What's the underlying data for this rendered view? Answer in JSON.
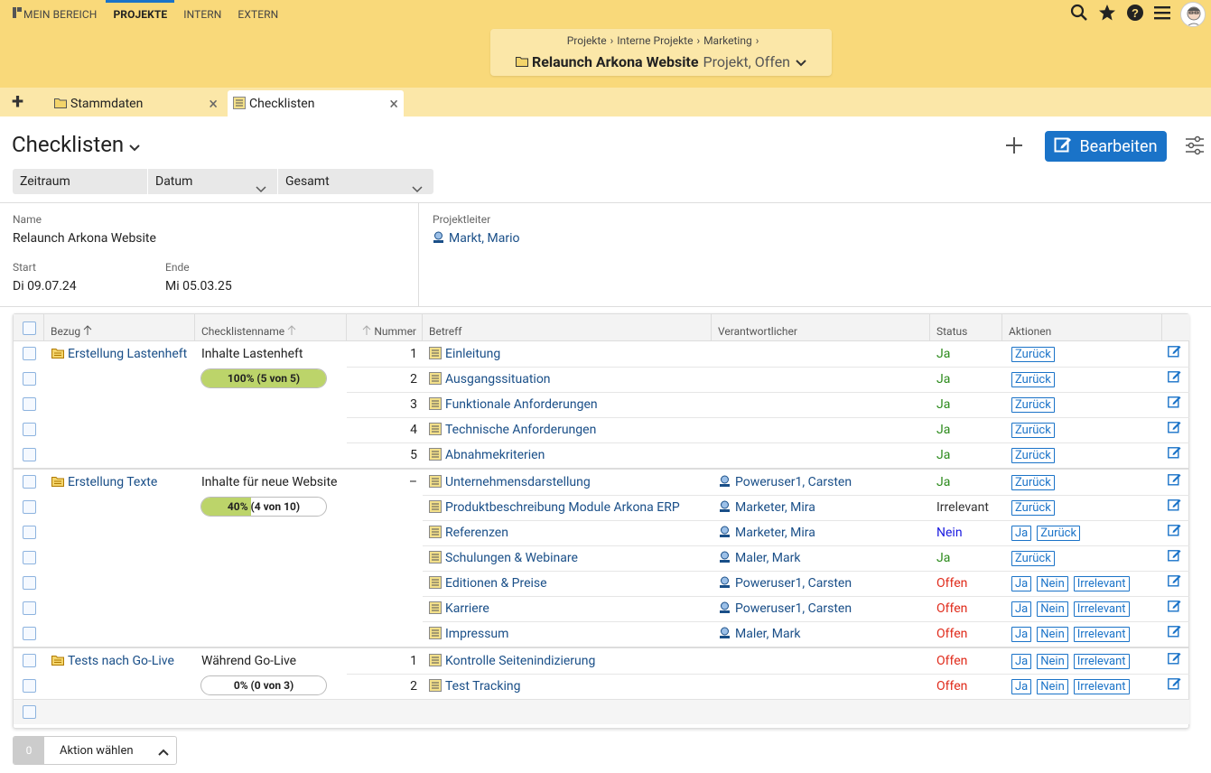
{
  "nav": {
    "items": [
      "MEIN BEREICH",
      "PROJEKTE",
      "INTERN",
      "EXTERN"
    ],
    "active_index": 1
  },
  "breadcrumb": [
    "Projekte",
    "Interne Projekte",
    "Marketing"
  ],
  "project": {
    "title": "Relaunch Arkona Website",
    "subtitle": "Projekt, Offen"
  },
  "tabs": [
    {
      "label": "Stammdaten"
    },
    {
      "label": "Checklisten"
    }
  ],
  "page": {
    "title": "Checklisten",
    "edit_label": "Bearbeiten"
  },
  "filters": [
    {
      "label": "Zeitraum"
    },
    {
      "label": "Datum"
    },
    {
      "label": "Gesamt"
    }
  ],
  "info": {
    "name_label": "Name",
    "name_value": "Relaunch Arkona Website",
    "start_label": "Start",
    "start_value": "Di 09.07.24",
    "end_label": "Ende",
    "end_value": "Mi 05.03.25",
    "lead_label": "Projektleiter",
    "lead_value": "Markt, Mario"
  },
  "table": {
    "headers": {
      "bezug": "Bezug",
      "checkliste": "Checklistenname",
      "nummer": "Nummer",
      "betreff": "Betreff",
      "verantwortlicher": "Verantwortlicher",
      "status": "Status",
      "aktionen": "Aktionen"
    },
    "groups": [
      {
        "bezug": "Erstellung Lastenheft",
        "checkliste": "Inhalte Lastenheft",
        "progress_label": "100% (5 von 5)",
        "progress": 1.0,
        "rows": [
          {
            "nummer": "1",
            "betreff": "Einleitung",
            "verantwortlicher": "",
            "status": "Ja",
            "actions": [
              "Zurück"
            ]
          },
          {
            "nummer": "2",
            "betreff": "Ausgangssituation",
            "verantwortlicher": "",
            "status": "Ja",
            "actions": [
              "Zurück"
            ]
          },
          {
            "nummer": "3",
            "betreff": "Funktionale Anforderungen",
            "verantwortlicher": "",
            "status": "Ja",
            "actions": [
              "Zurück"
            ]
          },
          {
            "nummer": "4",
            "betreff": "Technische Anforderungen",
            "verantwortlicher": "",
            "status": "Ja",
            "actions": [
              "Zurück"
            ]
          },
          {
            "nummer": "5",
            "betreff": "Abnahmekriterien",
            "verantwortlicher": "",
            "status": "Ja",
            "actions": [
              "Zurück"
            ]
          }
        ]
      },
      {
        "bezug": "Erstellung Texte",
        "checkliste": "Inhalte für neue Website",
        "progress_label": "40% (4 von 10)",
        "progress": 0.4,
        "rows": [
          {
            "nummer": "–",
            "betreff": "Unternehmensdarstellung",
            "verantwortlicher": "Poweruser1, Carsten",
            "status": "Ja",
            "actions": [
              "Zurück"
            ]
          },
          {
            "nummer": "",
            "betreff": "Produktbeschreibung Module Arkona ERP",
            "verantwortlicher": "Marketer, Mira",
            "status": "Irrelevant",
            "actions": [
              "Zurück"
            ]
          },
          {
            "nummer": "",
            "betreff": "Referenzen",
            "verantwortlicher": "Marketer, Mira",
            "status": "Nein",
            "actions": [
              "Ja",
              "Zurück"
            ]
          },
          {
            "nummer": "",
            "betreff": "Schulungen & Webinare",
            "verantwortlicher": "Maler, Mark",
            "status": "Ja",
            "actions": [
              "Zurück"
            ]
          },
          {
            "nummer": "",
            "betreff": "Editionen & Preise",
            "verantwortlicher": "Poweruser1, Carsten",
            "status": "Offen",
            "actions": [
              "Ja",
              "Nein",
              "Irrelevant"
            ]
          },
          {
            "nummer": "",
            "betreff": "Karriere",
            "verantwortlicher": "Poweruser1, Carsten",
            "status": "Offen",
            "actions": [
              "Ja",
              "Nein",
              "Irrelevant"
            ]
          },
          {
            "nummer": "",
            "betreff": "Impressum",
            "verantwortlicher": "Maler, Mark",
            "status": "Offen",
            "actions": [
              "Ja",
              "Nein",
              "Irrelevant"
            ]
          }
        ]
      },
      {
        "bezug": "Tests nach Go-Live",
        "checkliste": "Während Go-Live",
        "progress_label": "0% (0 von 3)",
        "progress": 0.0,
        "rows": [
          {
            "nummer": "1",
            "betreff": "Kontrolle Seitenindizierung",
            "verantwortlicher": "",
            "status": "Offen",
            "actions": [
              "Ja",
              "Nein",
              "Irrelevant"
            ]
          },
          {
            "nummer": "2",
            "betreff": "Test Tracking",
            "verantwortlicher": "",
            "status": "Offen",
            "actions": [
              "Ja",
              "Nein",
              "Irrelevant"
            ]
          }
        ]
      }
    ]
  },
  "footer": {
    "count": "0",
    "action_label": "Aktion wählen"
  },
  "colors": {
    "header_bg": "#f9d97a",
    "tab_bg": "#fbe7a8",
    "accent": "#1a73c8",
    "ja": "#2a8a1a",
    "nein": "#1a1ae0",
    "offen": "#e02a1a",
    "progress": "#bcd46a"
  }
}
